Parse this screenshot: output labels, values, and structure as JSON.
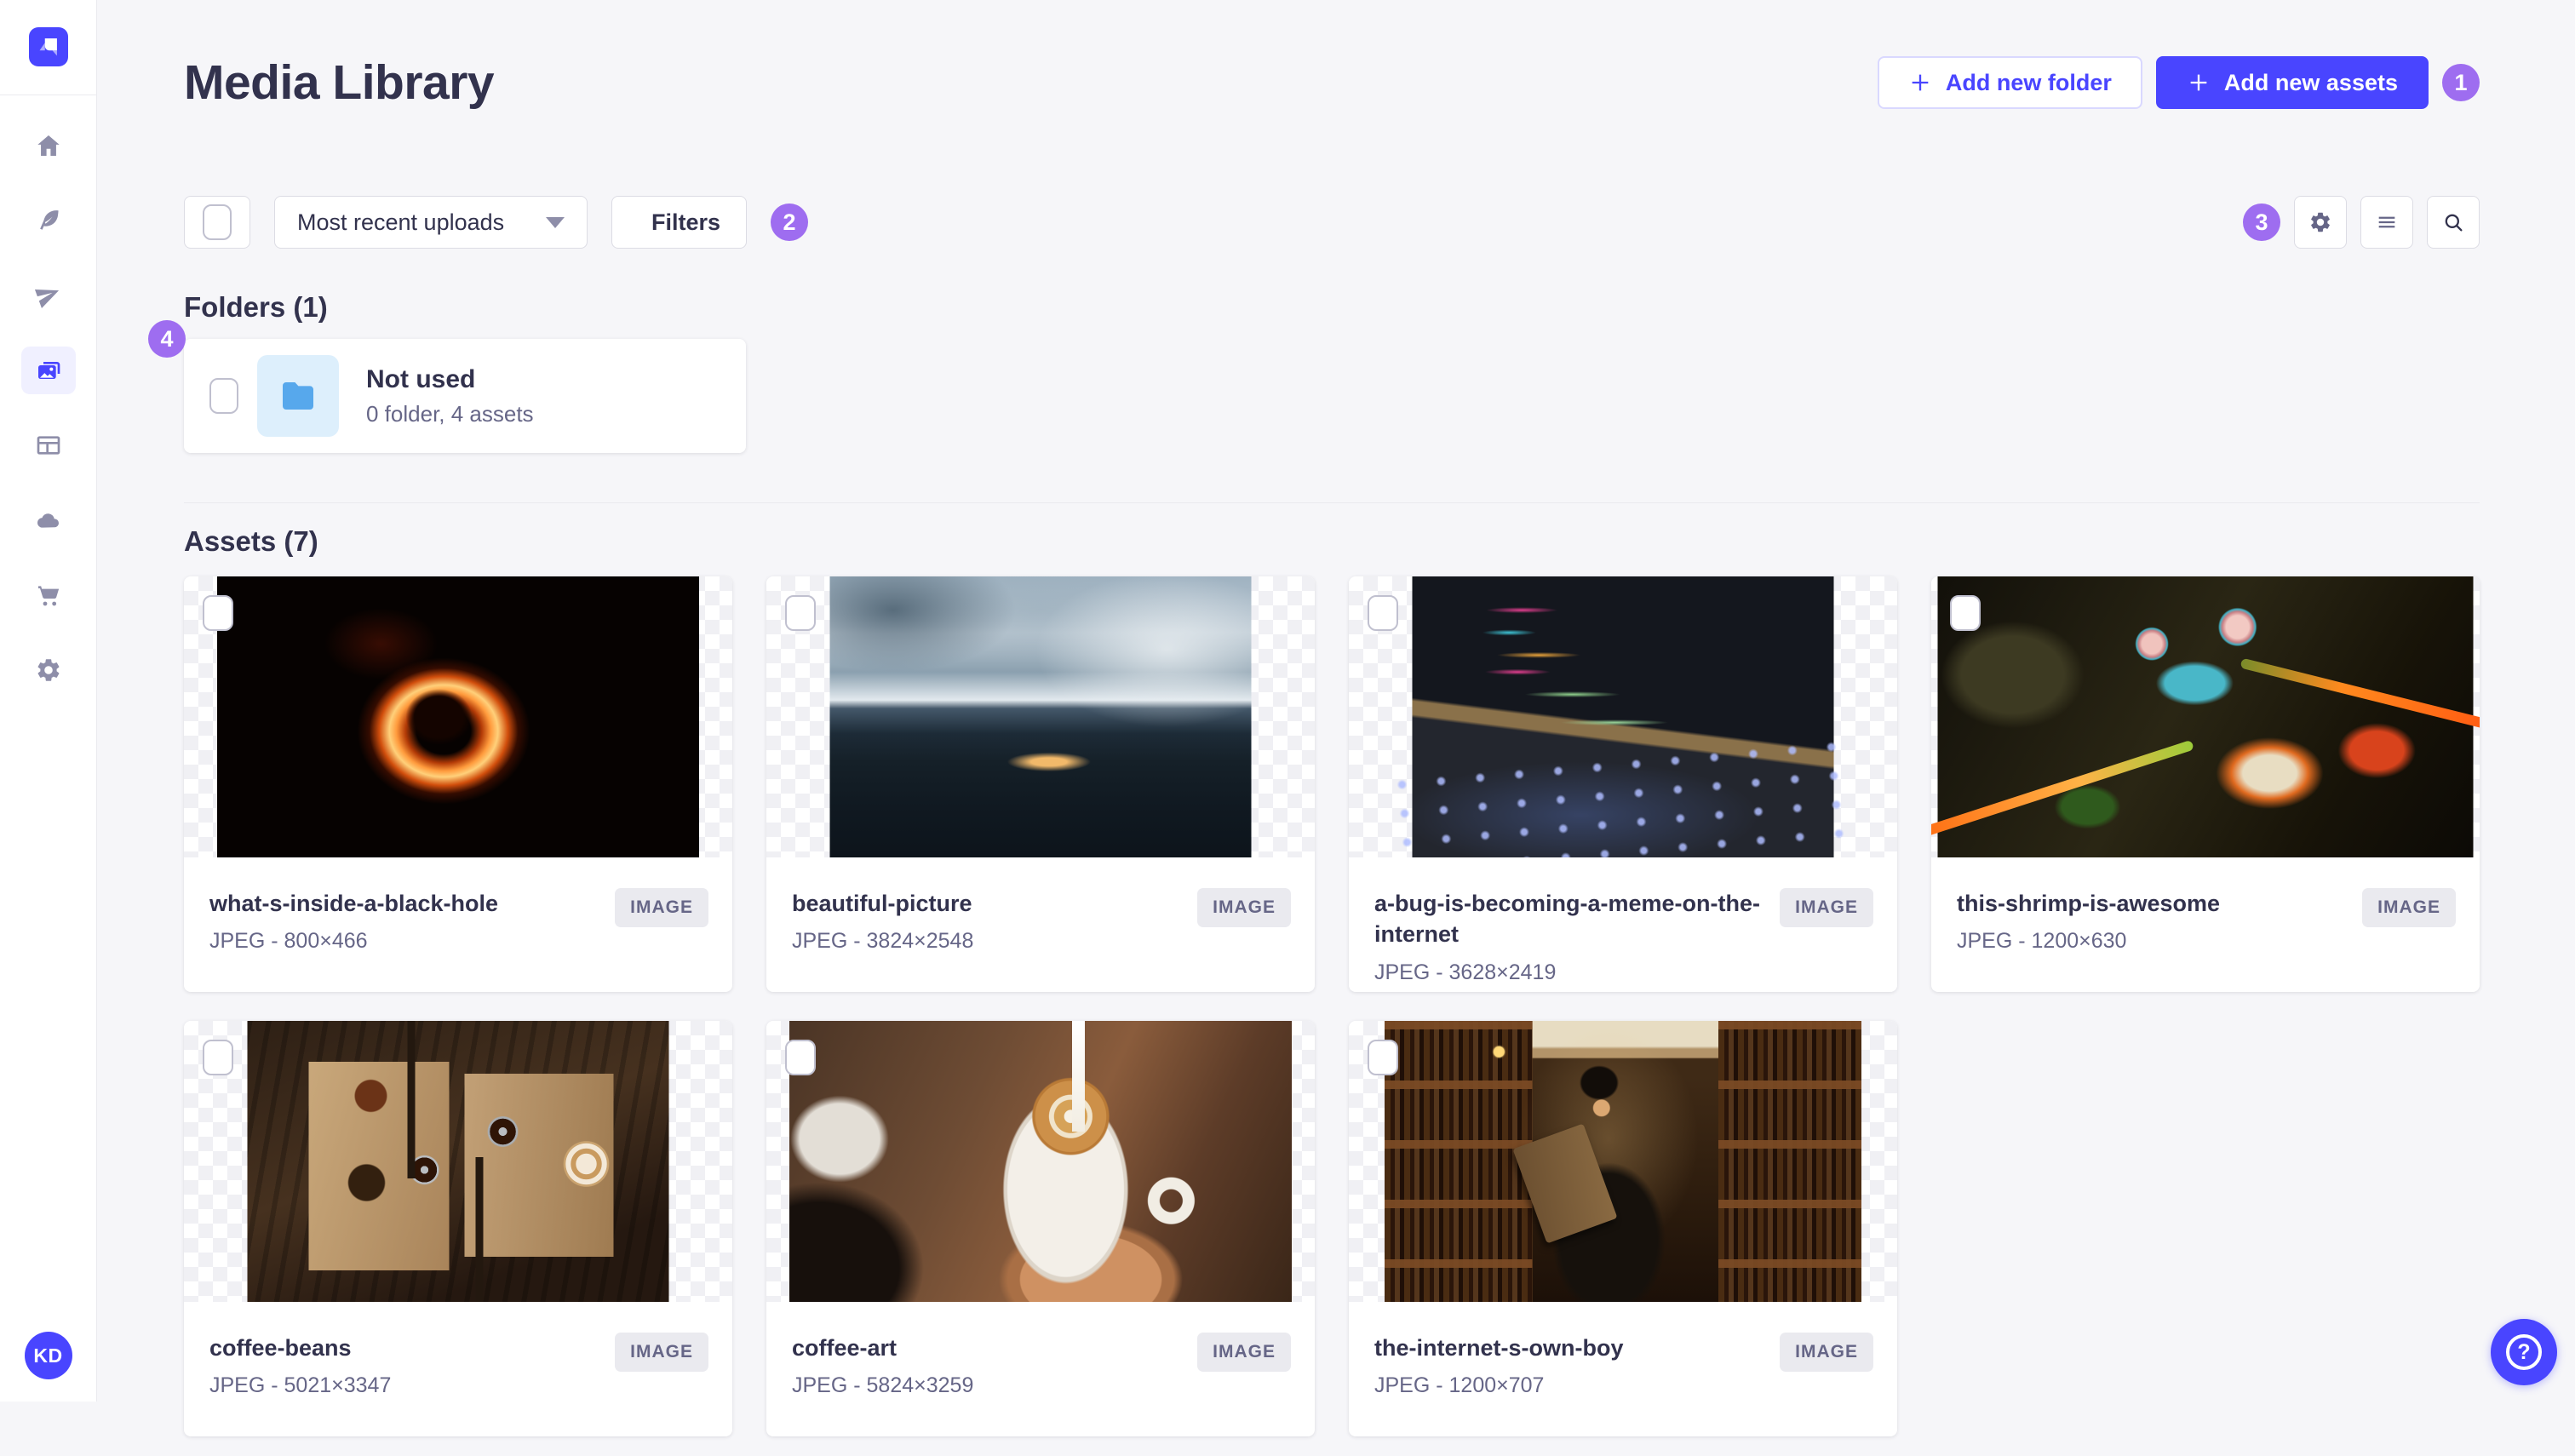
{
  "app": {
    "primary_color": "#4945ff",
    "annotation_color": "#9e6df0"
  },
  "sidebar": {
    "avatar_initials": "KD",
    "icons": [
      "home",
      "feather",
      "paper-plane",
      "media-library",
      "layout",
      "cloud",
      "cart",
      "settings"
    ],
    "active_item": "media-library"
  },
  "header": {
    "title": "Media Library",
    "add_folder_label": "Add new folder",
    "add_assets_label": "Add new assets"
  },
  "toolbar": {
    "sort_value": "Most recent uploads",
    "filters_label": "Filters",
    "icon_buttons": [
      "settings-gear",
      "list-view",
      "search"
    ]
  },
  "annotations": [
    "1",
    "2",
    "3",
    "4"
  ],
  "folders": {
    "heading": "Folders (1)",
    "items": [
      {
        "title": "Not used",
        "meta": "0 folder, 4 assets"
      }
    ]
  },
  "assets": {
    "heading": "Assets (7)",
    "type_badge": "IMAGE",
    "items": [
      {
        "title": "what-s-inside-a-black-hole",
        "meta": "JPEG - 800×466"
      },
      {
        "title": "beautiful-picture",
        "meta": "JPEG - 3824×2548"
      },
      {
        "title": "a-bug-is-becoming-a-meme-on-the-internet",
        "meta": "JPEG - 3628×2419"
      },
      {
        "title": "this-shrimp-is-awesome",
        "meta": "JPEG - 1200×630"
      },
      {
        "title": "coffee-beans",
        "meta": "JPEG - 5021×3347"
      },
      {
        "title": "coffee-art",
        "meta": "JPEG - 5824×3259"
      },
      {
        "title": "the-internet-s-own-boy",
        "meta": "JPEG - 1200×707"
      }
    ]
  },
  "fab": {
    "help": "?"
  }
}
